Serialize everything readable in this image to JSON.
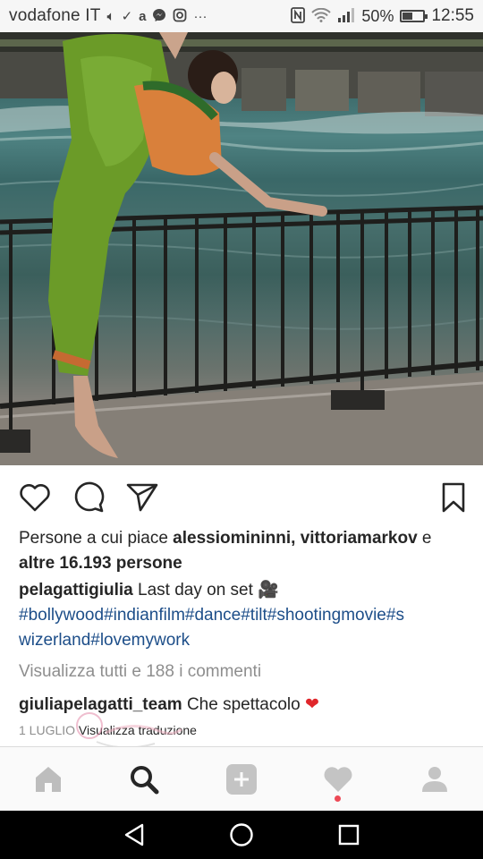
{
  "status_bar": {
    "carrier": "vodafone IT",
    "left_icons": [
      "volume-icon",
      "check-icon",
      "amazon-icon",
      "messenger-icon",
      "instagram-icon",
      "more-icon"
    ],
    "right_icons": [
      "nfc-icon",
      "wifi-icon",
      "signal-icon",
      "battery-icon"
    ],
    "battery_percent": "50%",
    "battery_level": 0.5,
    "time": "12:55"
  },
  "post": {
    "actions": {
      "like_icon": "heart-outline-icon",
      "comment_icon": "comment-icon",
      "share_icon": "send-icon",
      "save_icon": "bookmark-icon"
    },
    "likes": {
      "prefix": "Persone a cui piace ",
      "users": "alessiomininni, vittoriamarkov",
      "connector": " e",
      "others": "altre 16.193 persone"
    },
    "caption": {
      "username": "pelagattigiulia",
      "text": " Last day on set 🎥",
      "hashtags_line1": "#bollywood#indianfilm#dance#tilt#shootingmovie#s",
      "hashtags_line2": "wizerland#lovemywork"
    },
    "view_comments": "Visualizza tutti e 188 i commenti",
    "comment": {
      "username": "giuliapelagatti_team",
      "text": " Che spettacolo",
      "emoji": "❤️"
    },
    "date": "1 LUGLIO",
    "translate": "Visualizza traduzione"
  },
  "bottom_nav": {
    "items": [
      "home-icon",
      "search-icon",
      "add-icon",
      "activity-icon",
      "profile-icon"
    ],
    "active": "search",
    "notification_color": "#ed4956"
  },
  "system_nav": [
    "back-icon",
    "home-circle-icon",
    "recents-icon"
  ]
}
